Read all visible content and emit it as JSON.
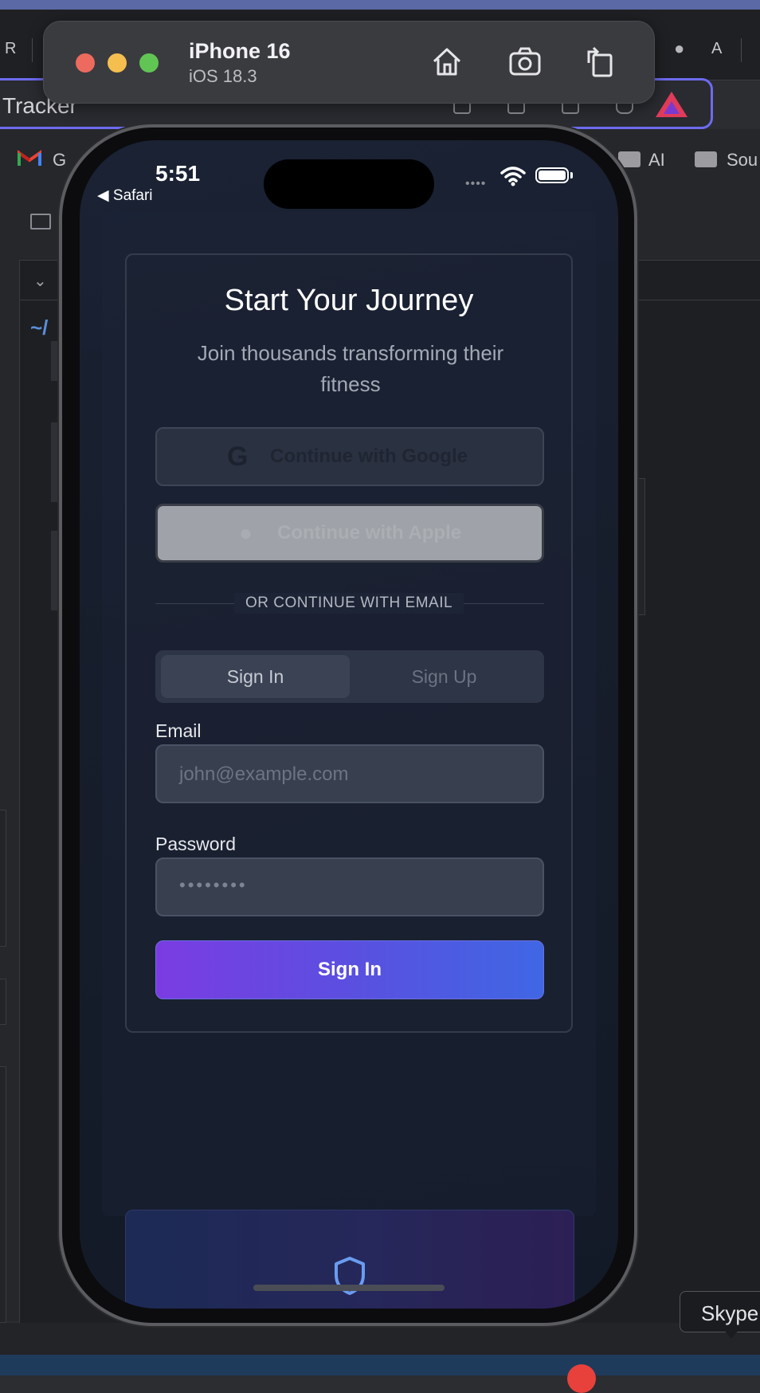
{
  "desktop": {
    "left_letter": "R",
    "right_letter": "A",
    "address_text": "Tracker",
    "bookmarks": [
      "G",
      "AI",
      "Sou"
    ],
    "path_text": "~/",
    "tooltip": "Skype"
  },
  "simulator": {
    "device": "iPhone 16",
    "os": "iOS 18.3",
    "icons": [
      "home-icon",
      "screenshot-icon",
      "rotate-icon"
    ]
  },
  "status_bar": {
    "time": "5:51",
    "back_label": "◀ Safari"
  },
  "auth_card": {
    "title": "Start Your Journey",
    "subtitle": "Join thousands transforming their fitness",
    "google_label": "Continue with Google",
    "apple_label": "Continue with Apple",
    "divider_label": "OR CONTINUE WITH EMAIL",
    "tabs": [
      {
        "label": "Sign In",
        "active": true
      },
      {
        "label": "Sign Up",
        "active": false
      }
    ],
    "email_label": "Email",
    "email_placeholder": "john@example.com",
    "password_label": "Password",
    "password_placeholder": "••••••••",
    "submit_label": "Sign In"
  },
  "colors": {
    "accent_start": "#7b3ce2",
    "accent_end": "#3f67e4",
    "focus_ring": "#6d6bf0"
  }
}
